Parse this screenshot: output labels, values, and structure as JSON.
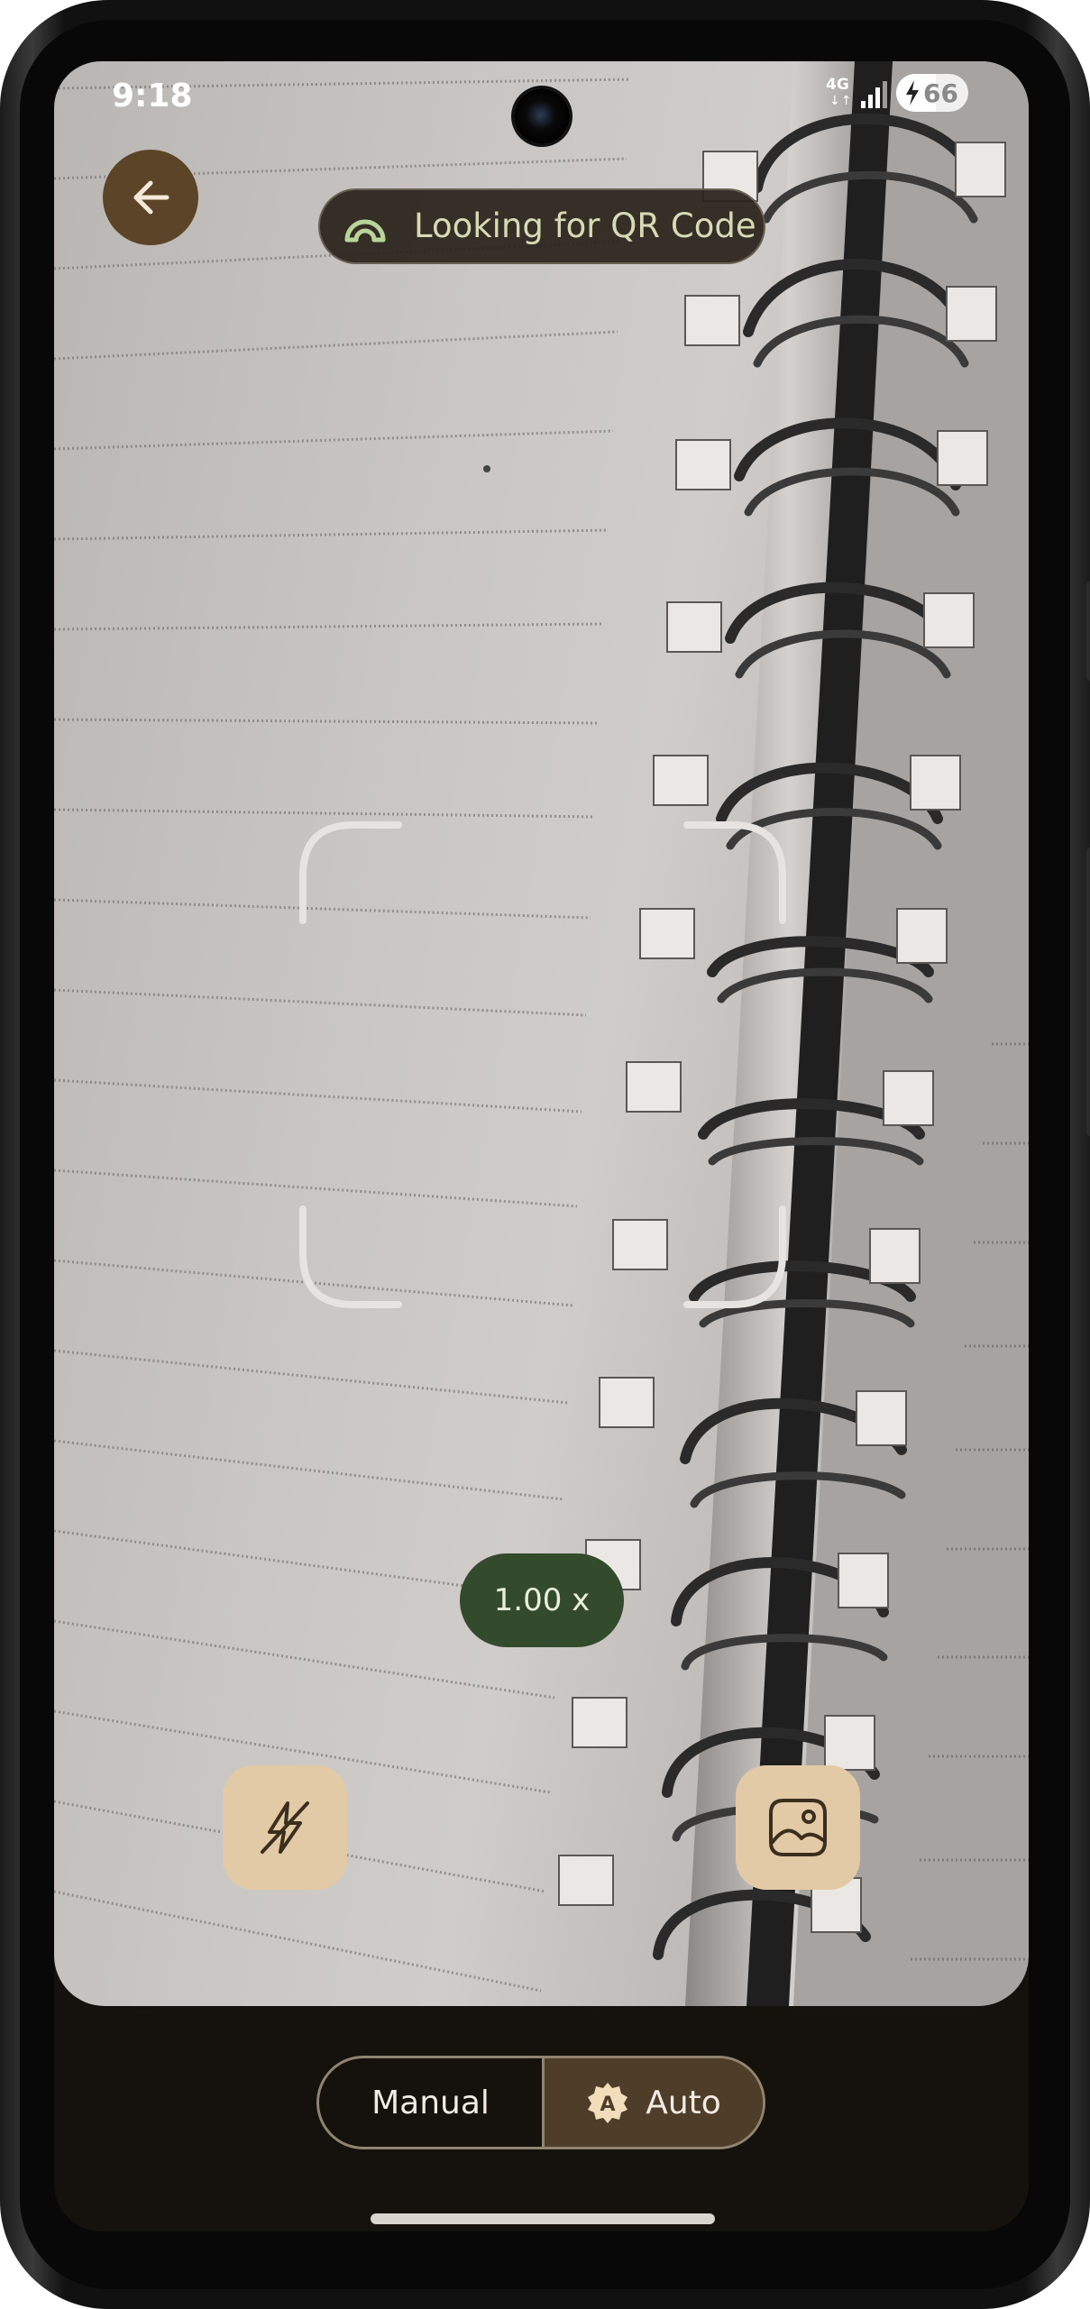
{
  "status_bar": {
    "time": "9:18",
    "network_type": "4G",
    "network_arrows": "↓↑",
    "battery_level": "66",
    "icons": [
      "signal-icon",
      "charging-bolt-icon",
      "battery-icon"
    ]
  },
  "header": {
    "back_icon": "arrow-left-icon",
    "scan_status_icon": "scan-target-icon",
    "scan_status_text": "Looking for QR Code"
  },
  "viewfinder": {
    "zoom_level": "1.00 x"
  },
  "controls": {
    "flash_icon": "flash-off-icon",
    "gallery_icon": "gallery-image-icon"
  },
  "mode_toggle": {
    "manual_label": "Manual",
    "auto_label": "Auto",
    "auto_icon": "auto-badge-icon",
    "selected": "Auto"
  },
  "colors": {
    "back_button_bg": "#5b4428",
    "zoom_pill_bg": "#344a2c",
    "action_button_bg": "#e2caa7",
    "selected_mode_bg": "#4e3d28",
    "app_bg": "#15110c",
    "scan_text": "#d7dbb4"
  }
}
